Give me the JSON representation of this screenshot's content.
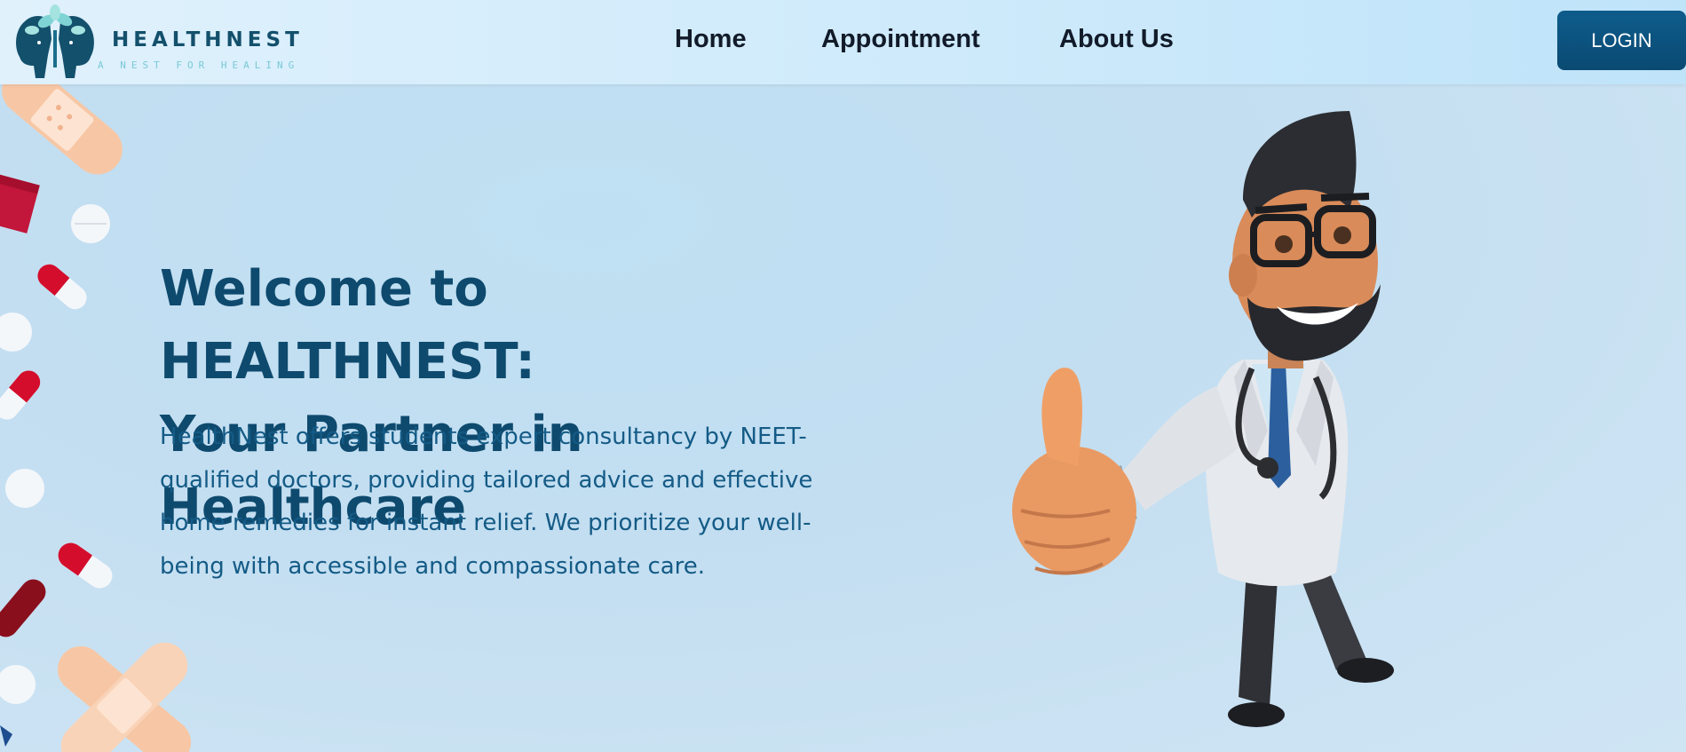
{
  "brand": {
    "name": "HEALTHNEST",
    "tagline": "A NEST FOR HEALING"
  },
  "nav": {
    "items": [
      {
        "label": "Home"
      },
      {
        "label": "Appointment"
      },
      {
        "label": "About Us"
      }
    ],
    "login_label": "LOGIN"
  },
  "hero": {
    "title_line1": "Welcome to HEALTHNEST:",
    "title_line2": "Your Partner in Healthcare",
    "description": "HealthNest offers students expert consultancy by NEET-qualified doctors, providing tailored advice and effective home remedies for instant relief. We prioritize your well-being with accessible and compassionate care."
  },
  "colors": {
    "brand_dark": "#0e4a6e",
    "accent": "#0e5c8c",
    "header_bg": "#d4ecfb",
    "hero_bg": "#c3def1"
  },
  "icons": {
    "logo": "twin-head-tree-logo-icon",
    "hero_left": "medicine-pills-decoration",
    "hero_right": "doctor-thumbs-up-illustration"
  }
}
